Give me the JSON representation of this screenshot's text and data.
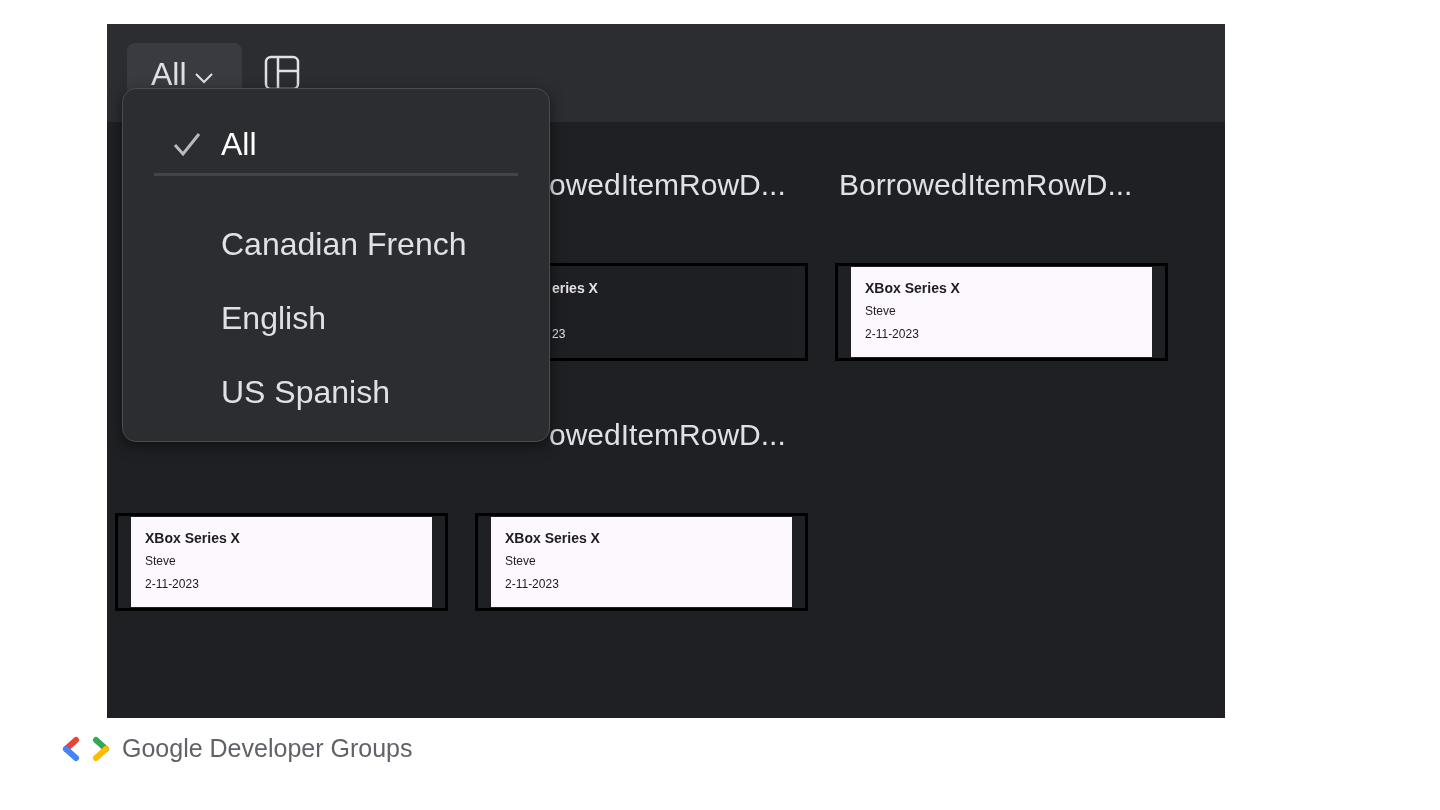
{
  "toolbar": {
    "filter": {
      "label": "All"
    }
  },
  "previews": [
    {
      "heading": "owedItemRowD...",
      "card": {
        "kind": "dark",
        "title": "eries X",
        "date": "23"
      }
    },
    {
      "heading": "BorrowedItemRowD...",
      "card": {
        "kind": "light",
        "title": "XBox Series X",
        "name": "Steve",
        "date": "2-11-2023"
      }
    },
    {
      "card": {
        "kind": "light",
        "title": "XBox Series X",
        "name": "Steve",
        "date": "2-11-2023"
      }
    },
    {
      "heading": "owedItemRowD...",
      "card": {
        "kind": "light",
        "title": "XBox Series X",
        "name": "Steve",
        "date": "2-11-2023"
      }
    }
  ],
  "menu": {
    "items": [
      {
        "label": "All",
        "selected": true
      },
      {
        "label": "Canadian French",
        "selected": false
      },
      {
        "label": "English",
        "selected": false
      },
      {
        "label": "US Spanish",
        "selected": false
      }
    ]
  },
  "footer": {
    "brand": "Google Developer Groups"
  }
}
